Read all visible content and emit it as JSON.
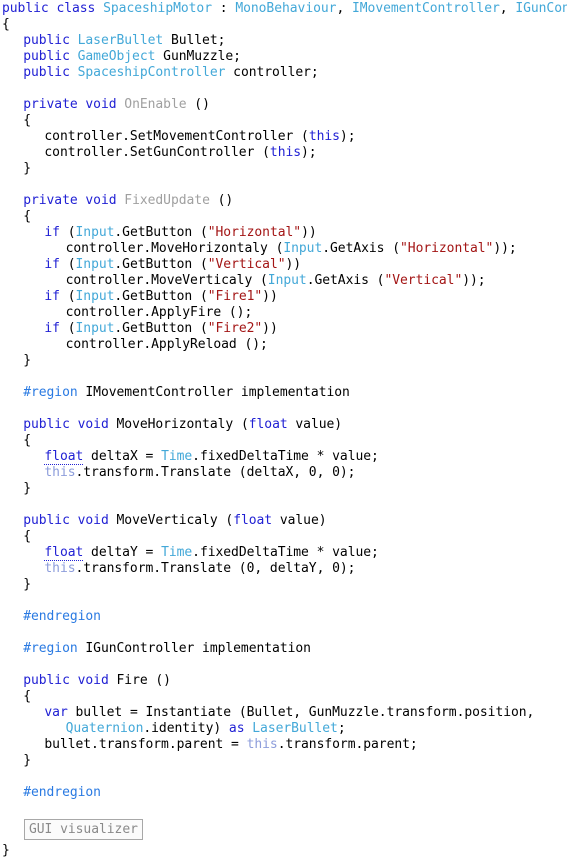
{
  "editor": {
    "language": "csharp",
    "background_color": "#ffffff",
    "font_size_px": 13,
    "line_height_px": 16,
    "colors": {
      "keyword": "#2121d4",
      "type": "#43a8d8",
      "string": "#a31515",
      "preprocessor": "#2a7ae2",
      "plain": "#000000",
      "unused_member": "#a0a0a0",
      "this_reference": "#8d9ddb",
      "widget_border": "#a8a8a8",
      "widget_text": "#8a8a8a",
      "widget_background": "#fbfbfb"
    },
    "file_class_name": "SpaceshipMotor",
    "base_type": "MonoBehaviour",
    "interfaces": [
      "IMovementController",
      "IGunController"
    ]
  },
  "widget": {
    "label": "GUI visualizer"
  },
  "code": {
    "lines": [
      {
        "indent": 0,
        "tokens": [
          {
            "t": "public ",
            "c": "kw"
          },
          {
            "t": "class ",
            "c": "kw"
          },
          {
            "t": "SpaceshipMotor",
            "c": "typ"
          },
          {
            "t": " : ",
            "c": "pln"
          },
          {
            "t": "MonoBehaviour",
            "c": "typ"
          },
          {
            "t": ", ",
            "c": "pln"
          },
          {
            "t": "IMovementController",
            "c": "typ"
          },
          {
            "t": ", ",
            "c": "pln"
          },
          {
            "t": "IGunController",
            "c": "typ"
          }
        ]
      },
      {
        "indent": 0,
        "tokens": [
          {
            "t": "{",
            "c": "pln"
          }
        ]
      },
      {
        "indent": 1,
        "tokens": [
          {
            "t": "public ",
            "c": "kw"
          },
          {
            "t": "LaserBullet",
            "c": "typ"
          },
          {
            "t": " Bullet;",
            "c": "pln"
          }
        ]
      },
      {
        "indent": 1,
        "tokens": [
          {
            "t": "public ",
            "c": "kw"
          },
          {
            "t": "GameObject",
            "c": "typ"
          },
          {
            "t": " GunMuzzle;",
            "c": "pln"
          }
        ]
      },
      {
        "indent": 1,
        "tokens": [
          {
            "t": "public ",
            "c": "kw"
          },
          {
            "t": "SpaceshipController",
            "c": "typ"
          },
          {
            "t": " controller;",
            "c": "pln"
          }
        ]
      },
      {
        "indent": 0,
        "tokens": []
      },
      {
        "indent": 1,
        "tokens": [
          {
            "t": "private ",
            "c": "kw"
          },
          {
            "t": "void ",
            "c": "kw"
          },
          {
            "t": "OnEnable",
            "c": "dim"
          },
          {
            "t": " ()",
            "c": "pln"
          }
        ]
      },
      {
        "indent": 1,
        "tokens": [
          {
            "t": "{",
            "c": "pln"
          }
        ]
      },
      {
        "indent": 2,
        "tokens": [
          {
            "t": "controller.SetMovementController (",
            "c": "pln"
          },
          {
            "t": "this",
            "c": "kw"
          },
          {
            "t": ");",
            "c": "pln"
          }
        ]
      },
      {
        "indent": 2,
        "tokens": [
          {
            "t": "controller.SetGunController (",
            "c": "pln"
          },
          {
            "t": "this",
            "c": "kw"
          },
          {
            "t": ");",
            "c": "pln"
          }
        ]
      },
      {
        "indent": 1,
        "tokens": [
          {
            "t": "}",
            "c": "pln"
          }
        ]
      },
      {
        "indent": 0,
        "tokens": []
      },
      {
        "indent": 1,
        "tokens": [
          {
            "t": "private ",
            "c": "kw"
          },
          {
            "t": "void ",
            "c": "kw"
          },
          {
            "t": "FixedUpdate",
            "c": "dim"
          },
          {
            "t": " ()",
            "c": "pln"
          }
        ]
      },
      {
        "indent": 1,
        "tokens": [
          {
            "t": "{",
            "c": "pln"
          }
        ]
      },
      {
        "indent": 2,
        "tokens": [
          {
            "t": "if",
            "c": "kw"
          },
          {
            "t": " (",
            "c": "pln"
          },
          {
            "t": "Input",
            "c": "typ"
          },
          {
            "t": ".GetButton (",
            "c": "pln"
          },
          {
            "t": "\"Horizontal\"",
            "c": "str"
          },
          {
            "t": "))",
            "c": "pln"
          }
        ]
      },
      {
        "indent": 3,
        "tokens": [
          {
            "t": "controller.MoveHorizontaly (",
            "c": "pln"
          },
          {
            "t": "Input",
            "c": "typ"
          },
          {
            "t": ".GetAxis (",
            "c": "pln"
          },
          {
            "t": "\"Horizontal\"",
            "c": "str"
          },
          {
            "t": "));",
            "c": "pln"
          }
        ]
      },
      {
        "indent": 2,
        "tokens": [
          {
            "t": "if",
            "c": "kw"
          },
          {
            "t": " (",
            "c": "pln"
          },
          {
            "t": "Input",
            "c": "typ"
          },
          {
            "t": ".GetButton (",
            "c": "pln"
          },
          {
            "t": "\"Vertical\"",
            "c": "str"
          },
          {
            "t": "))",
            "c": "pln"
          }
        ]
      },
      {
        "indent": 3,
        "tokens": [
          {
            "t": "controller.MoveVerticaly (",
            "c": "pln"
          },
          {
            "t": "Input",
            "c": "typ"
          },
          {
            "t": ".GetAxis (",
            "c": "pln"
          },
          {
            "t": "\"Vertical\"",
            "c": "str"
          },
          {
            "t": "));",
            "c": "pln"
          }
        ]
      },
      {
        "indent": 2,
        "tokens": [
          {
            "t": "if",
            "c": "kw"
          },
          {
            "t": " (",
            "c": "pln"
          },
          {
            "t": "Input",
            "c": "typ"
          },
          {
            "t": ".GetButton (",
            "c": "pln"
          },
          {
            "t": "\"Fire1\"",
            "c": "str"
          },
          {
            "t": "))",
            "c": "pln"
          }
        ]
      },
      {
        "indent": 3,
        "tokens": [
          {
            "t": "controller.ApplyFire ();",
            "c": "pln"
          }
        ]
      },
      {
        "indent": 2,
        "tokens": [
          {
            "t": "if",
            "c": "kw"
          },
          {
            "t": " (",
            "c": "pln"
          },
          {
            "t": "Input",
            "c": "typ"
          },
          {
            "t": ".GetButton (",
            "c": "pln"
          },
          {
            "t": "\"Fire2\"",
            "c": "str"
          },
          {
            "t": "))",
            "c": "pln"
          }
        ]
      },
      {
        "indent": 3,
        "tokens": [
          {
            "t": "controller.ApplyReload ();",
            "c": "pln"
          }
        ]
      },
      {
        "indent": 1,
        "tokens": [
          {
            "t": "}",
            "c": "pln"
          }
        ]
      },
      {
        "indent": 0,
        "tokens": []
      },
      {
        "indent": 1,
        "tokens": [
          {
            "t": "#region",
            "c": "pp"
          },
          {
            "t": " IMovementController implementation",
            "c": "pln"
          }
        ]
      },
      {
        "indent": 0,
        "tokens": []
      },
      {
        "indent": 1,
        "tokens": [
          {
            "t": "public ",
            "c": "kw"
          },
          {
            "t": "void ",
            "c": "kw"
          },
          {
            "t": "MoveHorizontaly",
            "c": "pln"
          },
          {
            "t": " (",
            "c": "pln"
          },
          {
            "t": "float",
            "c": "kw"
          },
          {
            "t": " value)",
            "c": "pln"
          }
        ]
      },
      {
        "indent": 1,
        "tokens": [
          {
            "t": "{",
            "c": "pln"
          }
        ]
      },
      {
        "indent": 2,
        "tokens": [
          {
            "t": "float",
            "c": "sugg"
          },
          {
            "t": " deltaX = ",
            "c": "pln"
          },
          {
            "t": "Time",
            "c": "typ"
          },
          {
            "t": ".fixedDeltaTime * value;",
            "c": "pln"
          }
        ]
      },
      {
        "indent": 2,
        "tokens": [
          {
            "t": "this",
            "c": "thisref"
          },
          {
            "t": ".transform.Translate (deltaX, 0, 0);",
            "c": "pln"
          }
        ]
      },
      {
        "indent": 1,
        "tokens": [
          {
            "t": "}",
            "c": "pln"
          }
        ]
      },
      {
        "indent": 0,
        "tokens": []
      },
      {
        "indent": 1,
        "tokens": [
          {
            "t": "public ",
            "c": "kw"
          },
          {
            "t": "void ",
            "c": "kw"
          },
          {
            "t": "MoveVerticaly",
            "c": "pln"
          },
          {
            "t": " (",
            "c": "pln"
          },
          {
            "t": "float",
            "c": "kw"
          },
          {
            "t": " value)",
            "c": "pln"
          }
        ]
      },
      {
        "indent": 1,
        "tokens": [
          {
            "t": "{",
            "c": "pln"
          }
        ]
      },
      {
        "indent": 2,
        "tokens": [
          {
            "t": "float",
            "c": "sugg"
          },
          {
            "t": " deltaY = ",
            "c": "pln"
          },
          {
            "t": "Time",
            "c": "typ"
          },
          {
            "t": ".fixedDeltaTime * value;",
            "c": "pln"
          }
        ]
      },
      {
        "indent": 2,
        "tokens": [
          {
            "t": "this",
            "c": "thisref"
          },
          {
            "t": ".transform.Translate (0, deltaY, 0);",
            "c": "pln"
          }
        ]
      },
      {
        "indent": 1,
        "tokens": [
          {
            "t": "}",
            "c": "pln"
          }
        ]
      },
      {
        "indent": 0,
        "tokens": []
      },
      {
        "indent": 1,
        "tokens": [
          {
            "t": "#endregion",
            "c": "pp"
          }
        ]
      },
      {
        "indent": 0,
        "tokens": []
      },
      {
        "indent": 1,
        "tokens": [
          {
            "t": "#region",
            "c": "pp"
          },
          {
            "t": " IGunController implementation",
            "c": "pln"
          }
        ]
      },
      {
        "indent": 0,
        "tokens": []
      },
      {
        "indent": 1,
        "tokens": [
          {
            "t": "public ",
            "c": "kw"
          },
          {
            "t": "void ",
            "c": "kw"
          },
          {
            "t": "Fire",
            "c": "pln"
          },
          {
            "t": " ()",
            "c": "pln"
          }
        ]
      },
      {
        "indent": 1,
        "tokens": [
          {
            "t": "{",
            "c": "pln"
          }
        ]
      },
      {
        "indent": 2,
        "tokens": [
          {
            "t": "var",
            "c": "kw"
          },
          {
            "t": " bullet = Instantiate (Bullet, GunMuzzle.transform.position,",
            "c": "pln"
          }
        ]
      },
      {
        "indent": 3,
        "tokens": [
          {
            "t": "Quaternion",
            "c": "typ"
          },
          {
            "t": ".identity) ",
            "c": "pln"
          },
          {
            "t": "as",
            "c": "kw"
          },
          {
            "t": " ",
            "c": "pln"
          },
          {
            "t": "LaserBullet",
            "c": "typ"
          },
          {
            "t": ";",
            "c": "pln"
          }
        ]
      },
      {
        "indent": 2,
        "tokens": [
          {
            "t": "bullet.transform.parent = ",
            "c": "pln"
          },
          {
            "t": "this",
            "c": "thisref"
          },
          {
            "t": ".transform.parent;",
            "c": "pln"
          }
        ]
      },
      {
        "indent": 1,
        "tokens": [
          {
            "t": "}",
            "c": "pln"
          }
        ]
      },
      {
        "indent": 0,
        "tokens": []
      },
      {
        "indent": 1,
        "tokens": [
          {
            "t": "#endregion",
            "c": "pp"
          }
        ]
      },
      {
        "indent": 0,
        "tokens": []
      },
      {
        "indent": 1,
        "widget": "gui-visualizer",
        "tokens": []
      },
      {
        "indent": 0,
        "tokens": [
          {
            "t": "}",
            "c": "pln"
          }
        ]
      }
    ]
  }
}
